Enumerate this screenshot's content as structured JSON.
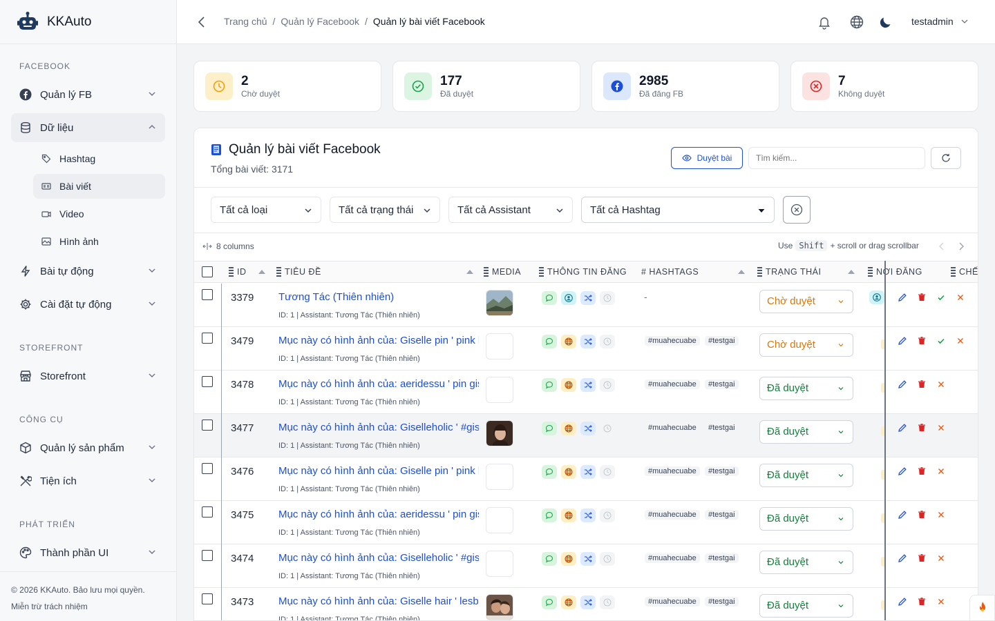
{
  "brand": {
    "name": "KKAuto"
  },
  "sidebar": {
    "sections": [
      "FACEBOOK",
      "STOREFRONT",
      "CÔNG CỤ",
      "PHÁT TRIỂN"
    ],
    "items": [
      {
        "label": "Quản lý FB",
        "icon": "facebook-icon"
      },
      {
        "label": "Dữ liệu",
        "icon": "database-icon"
      },
      {
        "label": "Bài tự động",
        "icon": "bolt-icon"
      },
      {
        "label": "Cài đặt tự động",
        "icon": "gear-icon"
      },
      {
        "label": "Storefront",
        "icon": "store-icon"
      },
      {
        "label": "Quản lý sản phẩm",
        "icon": "box-icon"
      },
      {
        "label": "Tiện ích",
        "icon": "tools-icon"
      },
      {
        "label": "Thành phần UI",
        "icon": "palette-icon"
      }
    ],
    "sub_items": [
      {
        "label": "Hashtag",
        "icon": "tag-icon"
      },
      {
        "label": "Bài viết",
        "icon": "article-icon"
      },
      {
        "label": "Video",
        "icon": "video-icon"
      },
      {
        "label": "Hình ảnh",
        "icon": "image-icon"
      }
    ],
    "footer_copyright": "© 2026 KKAuto. Bảo lưu mọi quyền.",
    "footer_disclaimer": "Miễn trừ trách nhiệm"
  },
  "header": {
    "breadcrumb": [
      "Trang chủ",
      "/",
      "Quản lý Facebook",
      "/",
      "Quản lý bài viết Facebook"
    ],
    "user": "testadmin"
  },
  "stats": [
    {
      "value": "2",
      "label": "Chờ duyệt",
      "color": "#f59e0b"
    },
    {
      "value": "177",
      "label": "Đã duyệt",
      "color": "#16a34a"
    },
    {
      "value": "2985",
      "label": "Đã đăng FB",
      "color": "#1d4ed8"
    },
    {
      "value": "7",
      "label": "Không duyệt",
      "color": "#dc2626"
    }
  ],
  "card": {
    "title": "Quản lý bài viết Facebook",
    "subtitle": "Tổng bài viết: 3171",
    "review_button": "Duyệt bài",
    "search_placeholder": "Tìm kiếm..."
  },
  "filters": [
    "Tất cả loại",
    "Tất cả trạng thái",
    "Tất cả Assistant",
    "Tất cả Hashtag"
  ],
  "colbar": {
    "columns_label": "8 columns",
    "hint_pre": "Use",
    "hint_key": "Shift",
    "hint_post": "+ scroll or drag scrollbar"
  },
  "columns": [
    "ID",
    "TIÊU ĐỀ",
    "MEDIA",
    "THÔNG TIN ĐĂNG",
    "# HASHTAGS",
    "TRẠNG THÁI",
    "NƠI ĐĂNG",
    "CHẾ"
  ],
  "rows": [
    {
      "id": "3379",
      "title": "Tương Tác (Thiên nhiên)",
      "meta": "ID: 1 | Assistant: Tương Tác (Thiên nhiên)",
      "hashtags": [
        "-"
      ],
      "status": "Chờ duyệt",
      "pending": true,
      "thumb": "landscape"
    },
    {
      "id": "3479",
      "title": "Mục này có hình ảnh của: Giselle pin ' pink h",
      "meta": "ID: 1 | Assistant: Tương Tác (Thiên nhiên)",
      "hashtags": [
        "#muahecuabe",
        "#testgai"
      ],
      "status": "Chờ duyệt",
      "pending": true,
      "thumb": "empty"
    },
    {
      "id": "3478",
      "title": "Mục này có hình ảnh của: aeridessu ' pin gis",
      "meta": "ID: 1 | Assistant: Tương Tác (Thiên nhiên)",
      "hashtags": [
        "#muahecuabe",
        "#testgai"
      ],
      "status": "Đã duyệt",
      "pending": false,
      "thumb": "empty"
    },
    {
      "id": "3477",
      "title": "Mục này có hình ảnh của: Giselleholic ' #gise",
      "meta": "ID: 1 | Assistant: Tương Tác (Thiên nhiên)",
      "hashtags": [
        "#muahecuabe",
        "#testgai"
      ],
      "status": "Đã duyệt",
      "pending": false,
      "thumb": "portrait"
    },
    {
      "id": "3476",
      "title": "Mục này có hình ảnh của: Giselle pin ' pink h",
      "meta": "ID: 1 | Assistant: Tương Tác (Thiên nhiên)",
      "hashtags": [
        "#muahecuabe",
        "#testgai"
      ],
      "status": "Đã duyệt",
      "pending": false,
      "thumb": "empty"
    },
    {
      "id": "3475",
      "title": "Mục này có hình ảnh của: aeridessu ' pin gis",
      "meta": "ID: 1 | Assistant: Tương Tác (Thiên nhiên)",
      "hashtags": [
        "#muahecuabe",
        "#testgai"
      ],
      "status": "Đã duyệt",
      "pending": false,
      "thumb": "empty"
    },
    {
      "id": "3474",
      "title": "Mục này có hình ảnh của: Giselleholic ' #gise",
      "meta": "ID: 1 | Assistant: Tương Tác (Thiên nhiên)",
      "hashtags": [
        "#muahecuabe",
        "#testgai"
      ],
      "status": "Đã duyệt",
      "pending": false,
      "thumb": "empty"
    },
    {
      "id": "3473",
      "title": "Mục này có hình ảnh của: Giselle hair ' lesbia",
      "meta": "ID: 1 | Assistant: Tương Tác (Thiên nhiên)",
      "hashtags": [
        "#muahecuabe",
        "#testgai"
      ],
      "status": "Đã duyệt",
      "pending": false,
      "thumb": "couple"
    }
  ],
  "colors": {
    "link": "#1d4ed8",
    "pending": "#d97706",
    "approved": "#15803d",
    "danger": "#dc2626"
  }
}
